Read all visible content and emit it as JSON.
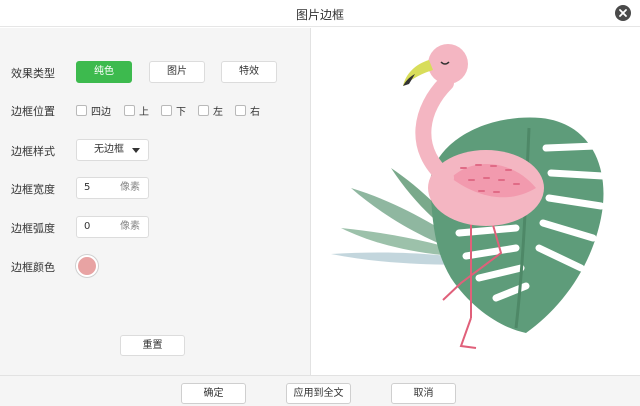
{
  "dialog": {
    "title": "图片边框"
  },
  "effect_type": {
    "label": "效果类型",
    "options": [
      "纯色",
      "图片",
      "特效"
    ],
    "selected": "纯色"
  },
  "border_position": {
    "label": "边框位置",
    "options": [
      "四边",
      "上",
      "下",
      "左",
      "右"
    ]
  },
  "border_style": {
    "label": "边框样式",
    "value": "无边框"
  },
  "border_width": {
    "label": "边框宽度",
    "value": "5",
    "unit": "像素"
  },
  "border_radius": {
    "label": "边框弧度",
    "value": "0",
    "unit": "像素"
  },
  "border_color": {
    "label": "边框颜色",
    "color": "#e8a3a3"
  },
  "reset_label": "重置",
  "footer": {
    "ok": "确定",
    "apply_all": "应用到全文",
    "cancel": "取消"
  },
  "preview": {
    "image": "flamingo-with-monstera-leaves"
  },
  "colors": {
    "accent": "#3dba4e",
    "panel": "#f5f5f5"
  }
}
